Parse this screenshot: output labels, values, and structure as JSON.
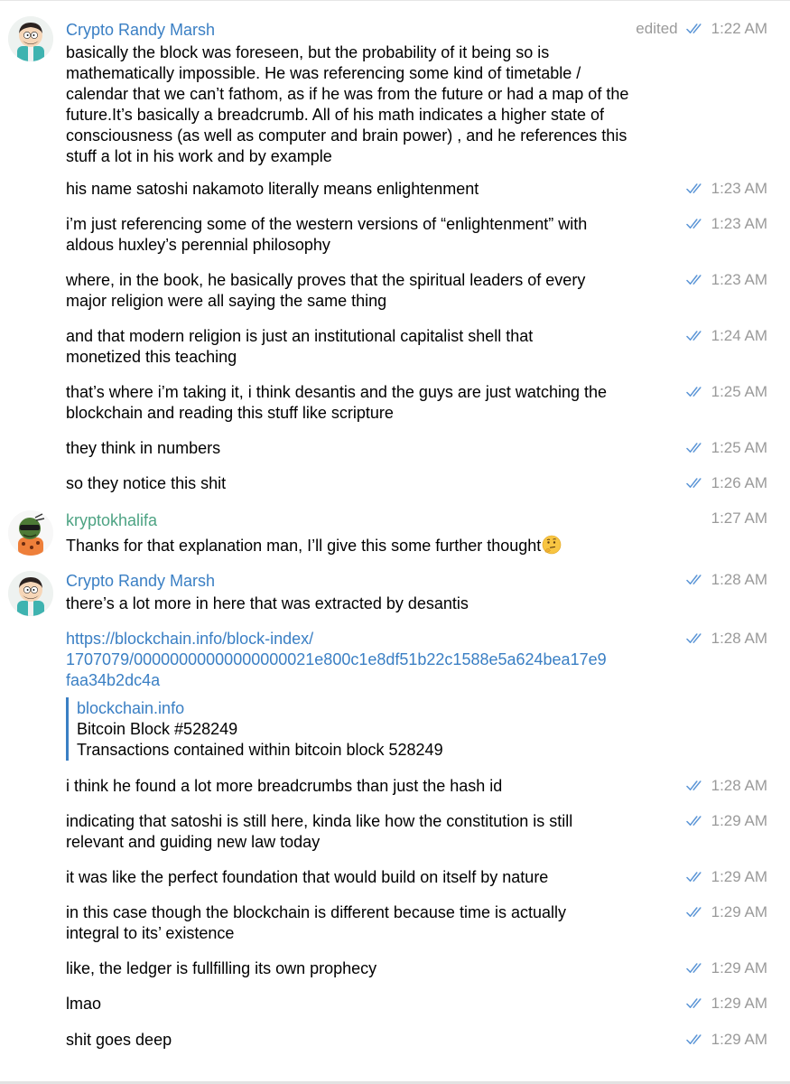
{
  "colors": {
    "sender_randy": "#3a7fc4",
    "sender_khalifa": "#4da383",
    "link": "#3a7fc4",
    "time_gray": "#9a9a9a",
    "check_blue": "#5b95d6"
  },
  "messages": [
    {
      "sender": "Crypto Randy Marsh",
      "edited": "edited",
      "time": "1:22 AM",
      "lines": [
        "basically the block was foreseen, but the probability of it being so is",
        "mathematically impossible. He was referencing some kind of timetable /",
        "calendar that we can’t fathom, as if he was from the future or had a map of the",
        "future.It’s basically a breadcrumb. All of his math indicates a higher state of",
        "consciousness (as well as computer and brain power) , and he references this",
        "stuff a lot in his work and by example"
      ]
    },
    {
      "time": "1:23 AM",
      "lines": [
        "his name satoshi nakamoto literally means enlightenment"
      ]
    },
    {
      "time": "1:23 AM",
      "lines": [
        "i’m just referencing some of the western versions of “enlightenment” with",
        "aldous huxley’s perennial philosophy"
      ]
    },
    {
      "time": "1:23 AM",
      "lines": [
        "where, in the book, he basically proves that the spiritual leaders of every",
        "major religion were all saying the same thing"
      ]
    },
    {
      "time": "1:24 AM",
      "lines": [
        "and that modern religion is just an institutional capitalist shell that",
        "monetized this teaching"
      ]
    },
    {
      "time": "1:25 AM",
      "lines": [
        "that’s where i’m taking it, i think desantis and the guys are just watching the",
        "blockchain and reading this stuff like scripture"
      ]
    },
    {
      "time": "1:25 AM",
      "lines": [
        "they think in numbers"
      ]
    },
    {
      "time": "1:26 AM",
      "lines": [
        "so they notice this shit"
      ]
    },
    {
      "sender": "kryptokhalifa",
      "time": "1:27 AM",
      "lines": [
        "Thanks for that explanation man, I’ll give this some further thought"
      ]
    },
    {
      "sender": "Crypto Randy Marsh",
      "time": "1:28 AM",
      "lines": [
        "there’s a lot more in here that was extracted by desantis"
      ]
    },
    {
      "time": "1:28 AM",
      "lines": [
        "https://blockchain.info/block-index/",
        "1707079/00000000000000000021e800c1e8df51b22c1588e5a624bea17e9",
        "faa34b2dc4a"
      ],
      "preview": {
        "site": "blockchain.info",
        "title": "Bitcoin Block #528249",
        "description": "Transactions contained within bitcoin block 528249"
      }
    },
    {
      "time": "1:28 AM",
      "lines": [
        "i think he found a lot more breadcrumbs than just the hash id"
      ]
    },
    {
      "time": "1:29 AM",
      "lines": [
        "indicating that satoshi is still here, kinda like how the constitution is still",
        "relevant and guiding new law today"
      ]
    },
    {
      "time": "1:29 AM",
      "lines": [
        "it was like the perfect foundation that would build on itself by nature"
      ]
    },
    {
      "time": "1:29 AM",
      "lines": [
        "in this case though the blockchain is different because time is actually",
        "integral to its’ existence"
      ]
    },
    {
      "time": "1:29 AM",
      "lines": [
        "like, the ledger is fullfilling its own prophecy"
      ]
    },
    {
      "time": "1:29 AM",
      "lines": [
        "lmao"
      ]
    },
    {
      "time": "1:29 AM",
      "lines": [
        "shit goes deep"
      ]
    }
  ]
}
